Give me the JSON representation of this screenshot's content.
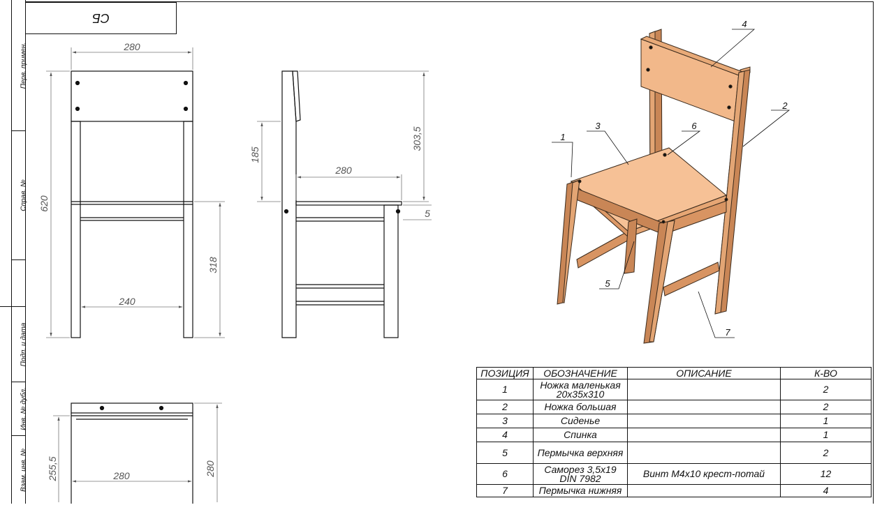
{
  "stamp": {
    "text": "СБ"
  },
  "side_strip": [
    {
      "label": "Перв. примен."
    },
    {
      "label": "Справ. №"
    },
    {
      "label": "Подп. и дата"
    },
    {
      "label": "Инв. № дубл."
    },
    {
      "label": "Взам. инв. №"
    }
  ],
  "dimensions": {
    "front_width": "280",
    "front_height": "620",
    "front_leg_span": "240",
    "front_seat_height": "318",
    "side_back_height": "185",
    "side_total": "303,5",
    "side_depth": "280",
    "side_seat_thickness": "5",
    "top_depth": "255,5",
    "top_width": "280",
    "top_side": "280"
  },
  "callouts": [
    "1",
    "2",
    "3",
    "4",
    "5",
    "6",
    "7"
  ],
  "spec_table": {
    "headers": [
      "ПОЗИЦИЯ",
      "ОБОЗНАЧЕНИЕ",
      "ОПИСАНИЕ",
      "К-ВО"
    ],
    "rows": [
      {
        "pos": "1",
        "name_l1": "Ножка маленькая",
        "name_l2": "20x35x310",
        "desc": "",
        "qty": "2"
      },
      {
        "pos": "2",
        "name_l1": "Ножка большая",
        "name_l2": "",
        "desc": "",
        "qty": "2"
      },
      {
        "pos": "3",
        "name_l1": "Сиденье",
        "name_l2": "",
        "desc": "",
        "qty": "1"
      },
      {
        "pos": "4",
        "name_l1": "Спинка",
        "name_l2": "",
        "desc": "",
        "qty": "1"
      },
      {
        "pos": "5",
        "name_l1": "Пермычка верхняя",
        "name_l2": "",
        "desc": "",
        "qty": "2"
      },
      {
        "pos": "6",
        "name_l1": "Саморез 3,5x19",
        "name_l2": "DIN 7982",
        "desc": "Винт М4x10 крест-потай",
        "qty": "12"
      },
      {
        "pos": "7",
        "name_l1": "Пермычка нижняя",
        "name_l2": "",
        "desc": "",
        "qty": "4"
      }
    ]
  },
  "colors": {
    "wood_light": "#f2b88a",
    "wood_mid": "#e0a06c",
    "wood_dark": "#b8764a",
    "line": "#111111",
    "dim": "#555555"
  }
}
